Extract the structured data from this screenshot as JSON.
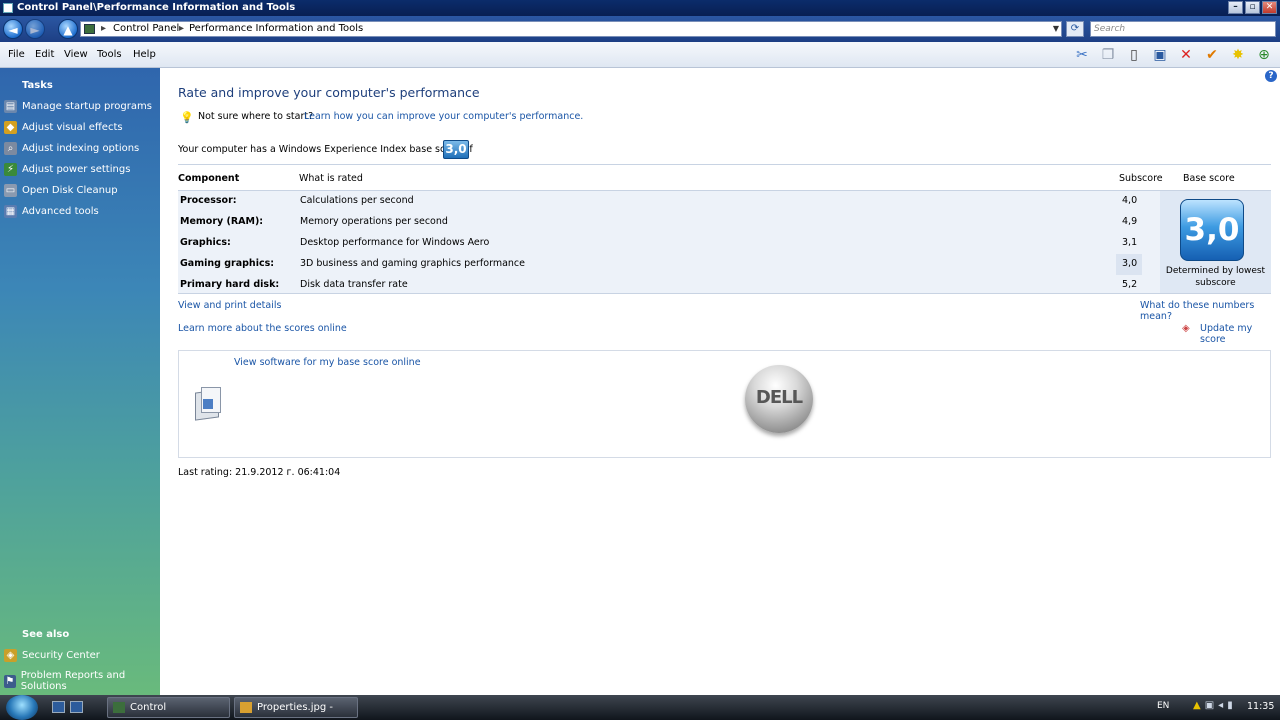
{
  "window": {
    "title": "Control Panel\\Performance Information and Tools",
    "controls": [
      "–",
      "▫",
      "✕"
    ]
  },
  "address": {
    "crumbs": [
      "Control Panel",
      "Performance Information and Tools"
    ],
    "separator": "▸",
    "search_placeholder": "Search"
  },
  "menu": [
    "File",
    "Edit",
    "View",
    "Tools",
    "Help"
  ],
  "toolbar_icons": [
    "scissors-icon",
    "copy-icon",
    "paste-icon",
    "properties-icon",
    "delete-icon",
    "check-icon",
    "new-icon",
    "globe-icon"
  ],
  "sidebar": {
    "tasks_heading": "Tasks",
    "tasks": [
      {
        "label": "Manage startup programs",
        "icon": "startup-icon"
      },
      {
        "label": "Adjust visual effects",
        "icon": "shield-icon"
      },
      {
        "label": "Adjust indexing options",
        "icon": "indexing-icon"
      },
      {
        "label": "Adjust power settings",
        "icon": "power-icon"
      },
      {
        "label": "Open Disk Cleanup",
        "icon": "disk-cleanup-icon"
      },
      {
        "label": "Advanced tools",
        "icon": "tools-icon"
      }
    ],
    "see_also_heading": "See also",
    "see_also": [
      {
        "label": "Security Center",
        "icon": "security-shield-icon"
      },
      {
        "label": "Problem Reports and Solutions",
        "icon": "problem-reports-icon"
      }
    ]
  },
  "main": {
    "title": "Rate and improve your computer's performance",
    "tip_text": "Not sure where to start?",
    "tip_link": "Learn how you can improve your computer's performance.",
    "base_text": "Your computer has a Windows Experience Index base score of",
    "base_score": "3,0",
    "headers": {
      "component": "Component",
      "rated": "What is rated",
      "subscore": "Subscore",
      "base": "Base score"
    },
    "rows": [
      {
        "component": "Processor:",
        "rated": "Calculations per second",
        "subscore": "4,0"
      },
      {
        "component": "Memory (RAM):",
        "rated": "Memory operations per second",
        "subscore": "4,9"
      },
      {
        "component": "Graphics:",
        "rated": "Desktop performance for Windows Aero",
        "subscore": "3,1"
      },
      {
        "component": "Gaming graphics:",
        "rated": "3D business and gaming graphics performance",
        "subscore": "3,0"
      },
      {
        "component": "Primary hard disk:",
        "rated": "Disk data transfer rate",
        "subscore": "5,2"
      }
    ],
    "determined": "Determined by lowest subscore",
    "links": {
      "view_print": "View and print details",
      "what_mean": "What do these numbers mean?",
      "learn_more": "Learn more about the scores online",
      "update": "Update my score",
      "view_software": "View software for my base score online"
    },
    "dell_text": "DELL",
    "last_rating": "Last rating: 21.9.2012 г. 06:41:04"
  },
  "taskbar": {
    "buttons": [
      "Control Panel\\Perfo...",
      "Properties.jpg - Paint"
    ],
    "lang": "EN",
    "clock": "11:35"
  },
  "colors": {
    "title_blue": "#1e3f7c",
    "link_blue": "#1a55a6",
    "table_bg": "#edf2f9"
  }
}
